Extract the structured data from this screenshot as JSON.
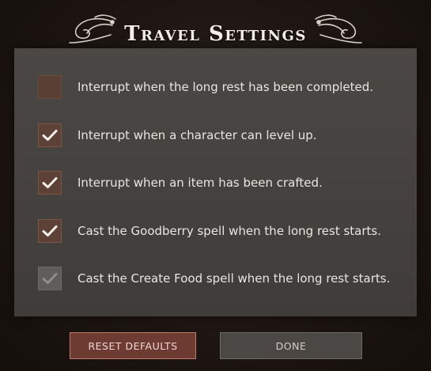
{
  "dialog": {
    "title": "Travel Settings"
  },
  "options": [
    {
      "label": "Interrupt when the long rest has been completed.",
      "checked": false,
      "enabled": true
    },
    {
      "label": "Interrupt when a character can level up.",
      "checked": true,
      "enabled": true
    },
    {
      "label": "Interrupt when an item has been crafted.",
      "checked": true,
      "enabled": true
    },
    {
      "label": "Cast the Goodberry spell when the long rest starts.",
      "checked": true,
      "enabled": true
    },
    {
      "label": "Cast the Create Food spell when the long rest starts.",
      "checked": true,
      "enabled": false
    }
  ],
  "buttons": {
    "reset_label": "RESET DEFAULTS",
    "done_label": "DONE"
  },
  "icons": {
    "checkmark": "checkmark-icon",
    "ornament": "flourish-ornament-icon"
  },
  "colors": {
    "panel": "#4a4744",
    "checkbox": "#5a3f34",
    "reset_button": "#6e3b33",
    "reset_border": "#c07a6a",
    "done_button": "#4a4745",
    "text": "#e9e6e2"
  }
}
